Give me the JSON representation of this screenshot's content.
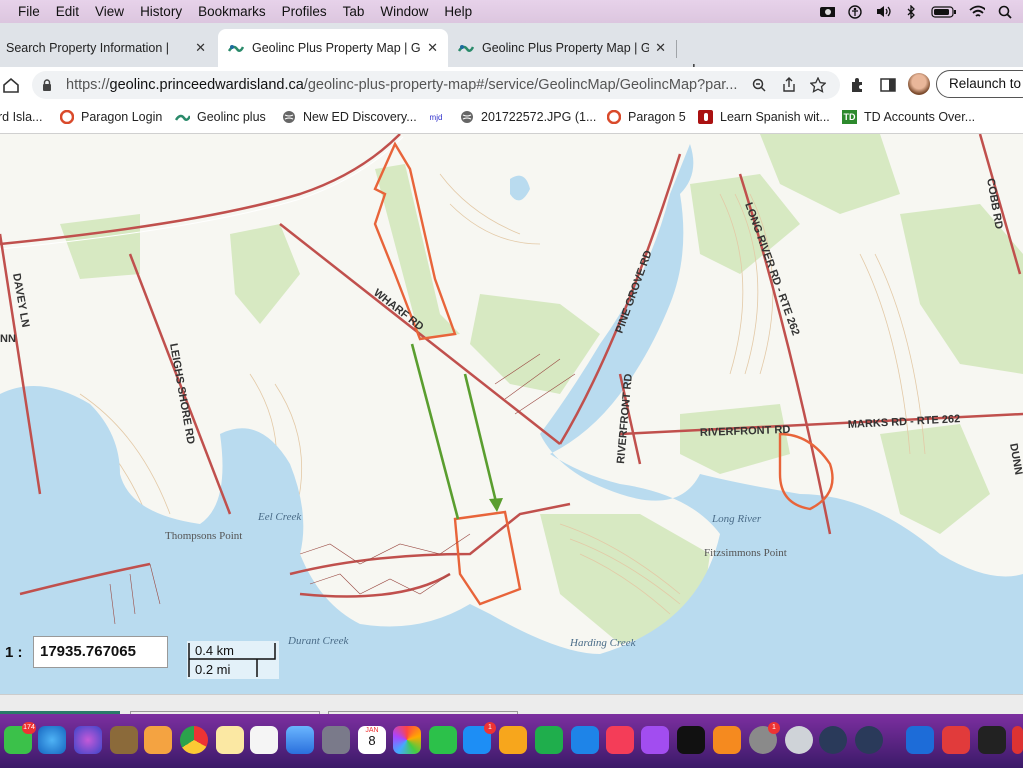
{
  "menubar": {
    "items": [
      "File",
      "Edit",
      "View",
      "History",
      "Bookmarks",
      "Profiles",
      "Tab",
      "Window",
      "Help"
    ],
    "status_icons": [
      "camera-icon",
      "accessibility-icon",
      "volume-icon",
      "bluetooth-icon",
      "battery-icon",
      "wifi-icon",
      "search-icon",
      "control-center-icon"
    ]
  },
  "tabs": [
    {
      "title": "Search Property Information |",
      "active": false
    },
    {
      "title": "Geolinc Plus Property Map | G",
      "active": true
    },
    {
      "title": "Geolinc Plus Property Map | G",
      "active": false
    }
  ],
  "address": {
    "url_prefix": "https://",
    "url_host": "geolinc.princeedwardisland.ca",
    "url_rest": "/geolinc-plus-property-map#/service/GeolincMap/GeolincMap?par...",
    "relaunch_label": "Relaunch to"
  },
  "bookmarks": [
    {
      "label": "rd Isla...",
      "icon": "geolinc-icon"
    },
    {
      "label": "Paragon Login",
      "icon": "paragon-icon"
    },
    {
      "label": "Geolinc plus",
      "icon": "geolinc-icon"
    },
    {
      "label": "New ED Discovery...",
      "icon": "globe-icon"
    },
    {
      "label": "201722572.JPG (1...",
      "icon": "globe-icon"
    },
    {
      "label": "Paragon 5",
      "icon": "paragon-icon"
    },
    {
      "label": "Learn Spanish wit...",
      "icon": "learn-icon"
    },
    {
      "label": "TD Accounts Over...",
      "icon": "td-icon"
    }
  ],
  "map": {
    "road_labels": [
      "WHARF RD",
      "PINE GROVE RD",
      "LONG RIVER RD - RTE 262",
      "COBB RD",
      "DAVEY LN",
      "LEIGHS SHORE RD",
      "RIVERFRONT RD",
      "RIVERFRONT RD",
      "MARKS RD - RTE 262",
      "DUNN",
      "NN"
    ],
    "place_labels": [
      "Thompsons Point",
      "Eel Creek",
      "Long River",
      "Fitzsimmons Point",
      "Durant Creek",
      "Harding Creek"
    ],
    "scale_prefix": "1 :",
    "scale_value": "17935.767065",
    "scalebar_km": "0.4 km",
    "scalebar_mi": "0.2 mi",
    "colors": {
      "water": "#b9dbef",
      "land": "#f7f7f2",
      "forest": "#d7e9c2",
      "road": "#c0504d",
      "parcel": "#e8643a",
      "arrow": "#5a9e2f"
    }
  },
  "dock": {
    "badges": {
      "messages": "174",
      "appstore": "1",
      "settings": "1"
    },
    "calendar_month": "JAN",
    "calendar_day": "8"
  }
}
